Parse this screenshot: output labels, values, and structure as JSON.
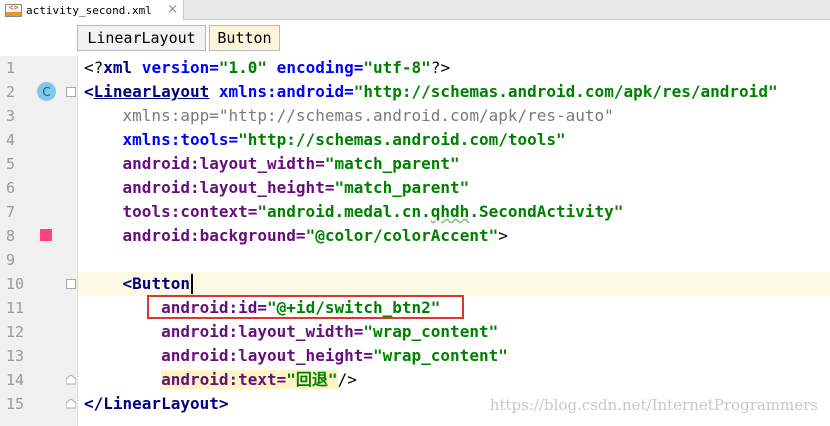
{
  "tab": {
    "icon": "xml-file-icon",
    "title": "activity_second.xml",
    "close": "×"
  },
  "breadcrumb": [
    "LinearLayout",
    "Button"
  ],
  "gutter": {
    "class_marker": "C",
    "lines": [
      "1",
      "2",
      "3",
      "4",
      "5",
      "6",
      "7",
      "8",
      "9",
      "10",
      "11",
      "12",
      "13",
      "14",
      "15"
    ]
  },
  "code": {
    "l1": {
      "a": "<?",
      "b": "xml",
      "c": " version=",
      "d": "\"1.0\"",
      "e": " encoding=",
      "f": "\"utf-8\"",
      "g": "?>"
    },
    "l2": {
      "a": "<",
      "b": "LinearLayout",
      "c": " xmlns:android=",
      "d": "\"http://schemas.android.com/apk/res/android\""
    },
    "l3": {
      "a": "    xmlns:app=",
      "b": "\"http://schemas.android.com/apk/res-auto\""
    },
    "l4": {
      "a": "    xmlns:tools=",
      "b": "\"http://schemas.android.com/tools\""
    },
    "l5": {
      "a": "    android:layout_width=",
      "b": "\"match_parent\""
    },
    "l6": {
      "a": "    android:layout_height=",
      "b": "\"match_parent\""
    },
    "l7": {
      "a": "    tools:context=",
      "b": "\"android.medal.cn.",
      "c": "qhdh",
      "d": ".SecondActivity\""
    },
    "l8": {
      "a": "    android:background=",
      "b": "\"@color/colorAccent\"",
      "c": ">"
    },
    "l10": {
      "a": "    <",
      "b": "Button"
    },
    "l11": {
      "a": "        android:id=",
      "b": "\"@+id/switch_btn2\""
    },
    "l12": {
      "a": "        android:layout_width=",
      "b": "\"wrap_content\""
    },
    "l13": {
      "a": "        android:layout_height=",
      "b": "\"wrap_content\""
    },
    "l14": {
      "a": "android:text=",
      "b": "\"回退\"",
      "c": "/>"
    },
    "l15": {
      "a": "</",
      "b": "LinearLayout",
      "c": ">"
    }
  },
  "watermark": "https://blog.csdn.net/InternetProgrammers",
  "colors": {
    "accent_swatch": "#ff4081",
    "highlight_box": "#e03333"
  }
}
